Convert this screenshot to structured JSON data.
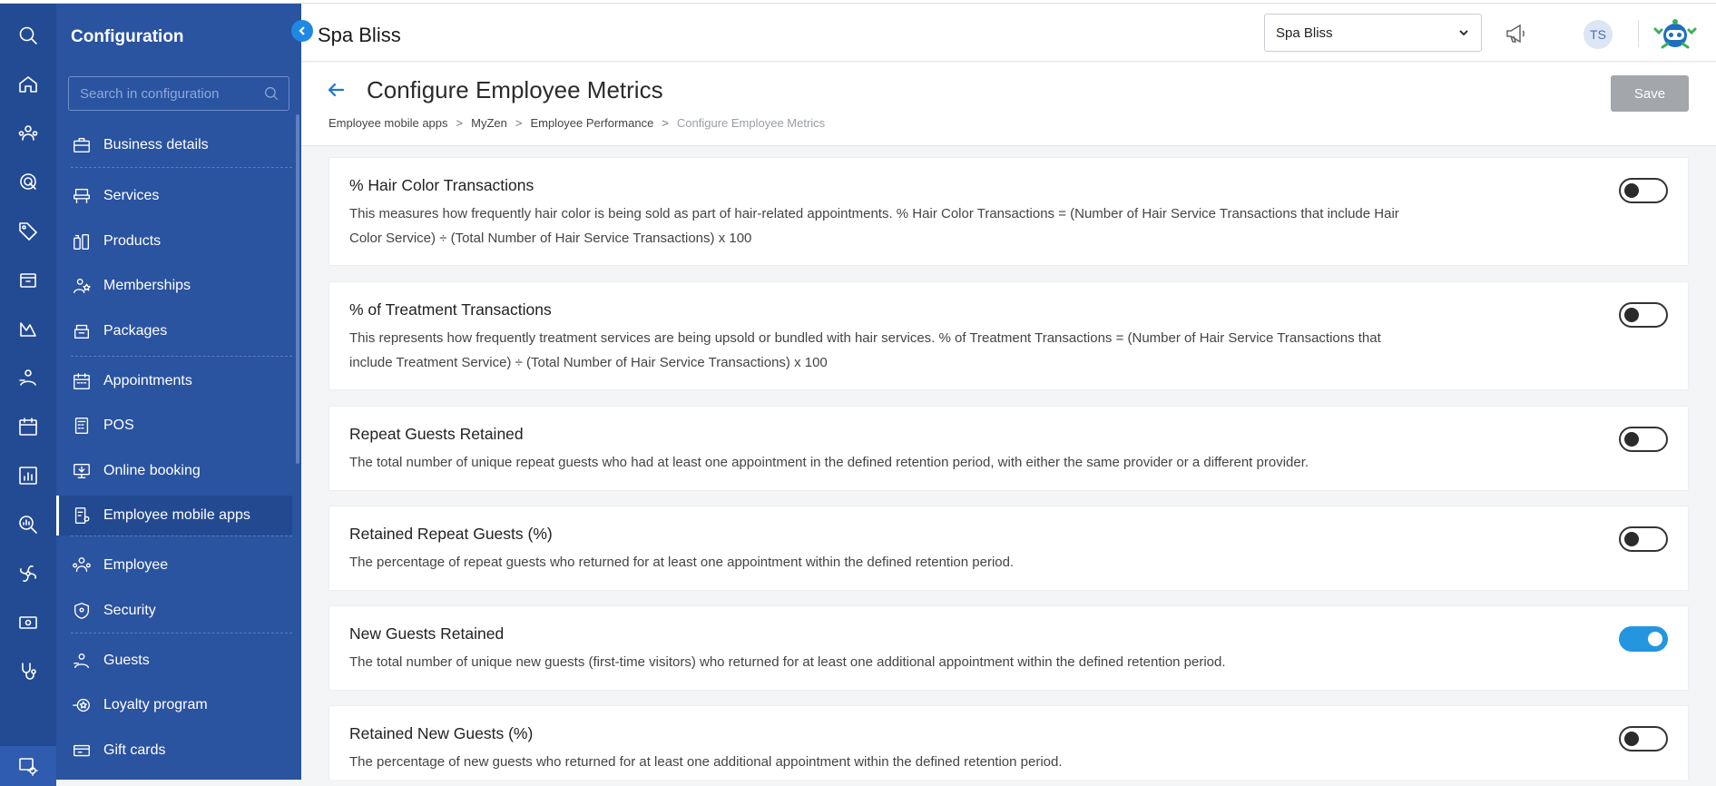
{
  "app": {
    "brand": "Spa Bliss"
  },
  "topbar": {
    "location_select": "Spa Bliss",
    "avatar_initials": "TS"
  },
  "config_panel": {
    "title": "Configuration",
    "search_placeholder": "Search in configuration",
    "items": [
      {
        "label": "Business details",
        "icon": "briefcase-icon"
      },
      {
        "label": "Services",
        "icon": "salon-chair-icon"
      },
      {
        "label": "Products",
        "icon": "products-icon"
      },
      {
        "label": "Memberships",
        "icon": "membership-icon"
      },
      {
        "label": "Packages",
        "icon": "package-icon"
      },
      {
        "label": "Appointments",
        "icon": "calendar-icon"
      },
      {
        "label": "POS",
        "icon": "pos-icon"
      },
      {
        "label": "Online booking",
        "icon": "online-booking-icon"
      },
      {
        "label": "Employee mobile apps",
        "icon": "mobile-app-icon",
        "active": true
      },
      {
        "label": "Employee",
        "icon": "employee-icon"
      },
      {
        "label": "Security",
        "icon": "shield-icon"
      },
      {
        "label": "Guests",
        "icon": "guests-icon"
      },
      {
        "label": "Loyalty program",
        "icon": "loyalty-icon"
      },
      {
        "label": "Gift cards",
        "icon": "gift-card-icon"
      }
    ]
  },
  "header": {
    "title": "Configure Employee Metrics",
    "breadcrumb": [
      "Employee mobile apps",
      "MyZen",
      "Employee Performance",
      "Configure Employee Metrics"
    ],
    "breadcrumb_sep": ">",
    "save_label": "Save"
  },
  "metrics": [
    {
      "title": "% Hair Color Transactions",
      "description": "This measures how frequently hair color is being sold as part of hair-related appointments. % Hair Color Transactions = (Number of Hair Service Transactions that include Hair Color Service) ÷ (Total Number of Hair Service Transactions) x 100",
      "enabled": false
    },
    {
      "title": "% of Treatment Transactions",
      "description": "This represents how frequently treatment services are being upsold or bundled with hair services. % of Treatment Transactions = (Number of Hair Service Transactions that include Treatment Service) ÷ (Total Number of Hair Service Transactions) x 100",
      "enabled": false
    },
    {
      "title": "Repeat Guests Retained",
      "description": "The total number of unique repeat guests who had at least one appointment in the defined retention period, with either the same provider or a different provider.",
      "enabled": false
    },
    {
      "title": "Retained Repeat Guests (%)",
      "description": "The percentage of repeat guests who returned for at least one appointment within the defined retention period.",
      "enabled": false
    },
    {
      "title": "New Guests Retained",
      "description": "The total number of unique new guests (first-time visitors) who returned for at least one additional appointment within the defined retention period.",
      "enabled": true
    },
    {
      "title": "Retained New Guests (%)",
      "description": "The percentage of new guests who returned for at least one additional appointment within the defined retention period.",
      "enabled": false
    }
  ],
  "colors": {
    "rail": "#234b94",
    "panel": "#2a53a0",
    "accent": "#2496e0"
  }
}
